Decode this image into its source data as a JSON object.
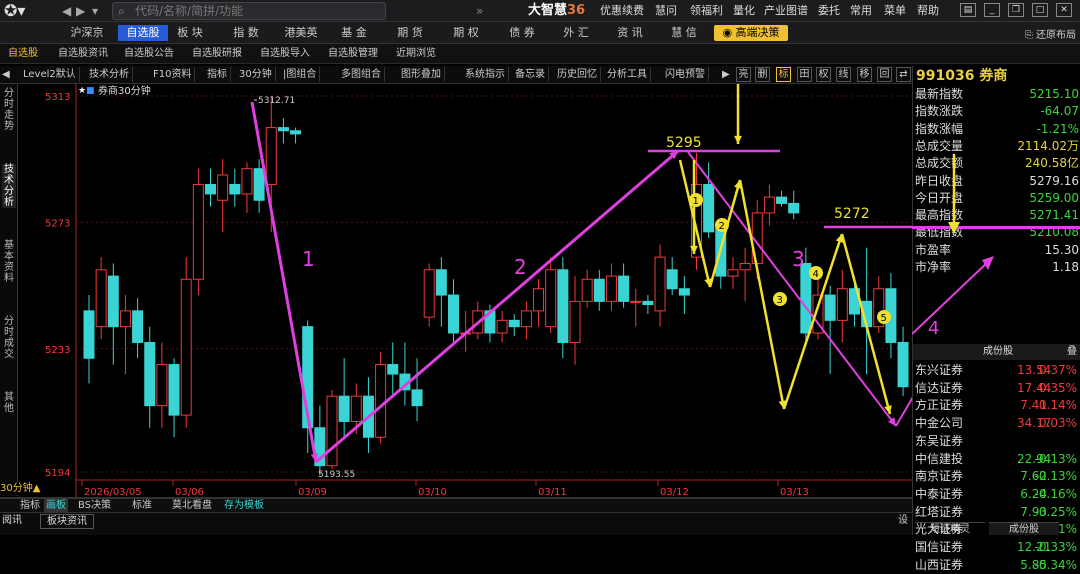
{
  "topbar": {
    "search_placeholder": "代码/名称/简拼/功能",
    "brand": "大智慧",
    "brand_num": "36",
    "menus": [
      "优惠续费",
      "慧问",
      "领福利",
      "量化",
      "产业图谱",
      "委托",
      "常用",
      "菜单",
      "帮助"
    ]
  },
  "menubar": {
    "items": [
      "沪深京",
      "自选股",
      "板 块",
      "指 数",
      "港美英",
      "基 金",
      "期 货",
      "期 权",
      "债 券",
      "外 汇",
      "资 讯",
      "慧 信"
    ],
    "gold": "高端决策",
    "restore": "还原布局"
  },
  "subbar": {
    "items": [
      "自选股",
      "自选股资讯",
      "自选股公告",
      "自选股研报",
      "自选股导入",
      "自选股管理",
      "近期浏览"
    ]
  },
  "toolbar": {
    "items": [
      "Level2默认",
      "技术分析",
      "F10资料",
      "指标",
      "30分钟",
      "|图组合",
      "多图组合",
      "图形叠加",
      "系统指示",
      "备忘录",
      "历史回忆",
      "分析工具",
      "闪电预警"
    ],
    "squares": [
      "亮",
      "删",
      "标",
      "田",
      "权",
      "线",
      "移",
      "回",
      "⇄"
    ]
  },
  "sidetabs": [
    "分时走势",
    "技术分析",
    "基本资料",
    "分时成交",
    "其他"
  ],
  "chart_data": {
    "type": "candlestick",
    "title": "券商30分钟",
    "period": "30分钟",
    "yticks": [
      "5313",
      "5273",
      "5233",
      "5194"
    ],
    "ylim": [
      5194,
      5313
    ],
    "xticks": [
      "2026/03/05",
      "03/06",
      "03/09",
      "03/10",
      "03/11",
      "03/12",
      "03/13"
    ],
    "hi_label": "5312.71",
    "lo_label": "5193.55",
    "annotations": {
      "wave_labels": [
        "1",
        "2",
        "3",
        "4"
      ],
      "level_labels": [
        "5295",
        "5272"
      ],
      "circle_labels": [
        "1",
        "2",
        "3",
        "4",
        "5"
      ]
    },
    "candles": [
      [
        5245,
        5230,
        5222,
        5250
      ],
      [
        5240,
        5258,
        5236,
        5262
      ],
      [
        5256,
        5240,
        5228,
        5260
      ],
      [
        5240,
        5245,
        5225,
        5250
      ],
      [
        5245,
        5235,
        5230,
        5249
      ],
      [
        5235,
        5215,
        5208,
        5240
      ],
      [
        5215,
        5228,
        5208,
        5235
      ],
      [
        5228,
        5212,
        5205,
        5230
      ],
      [
        5212,
        5255,
        5208,
        5262
      ],
      [
        5255,
        5285,
        5250,
        5290
      ],
      [
        5285,
        5282,
        5278,
        5290
      ],
      [
        5280,
        5288,
        5270,
        5293
      ],
      [
        5285,
        5282,
        5278,
        5290
      ],
      [
        5282,
        5290,
        5276,
        5292
      ],
      [
        5290,
        5280,
        5276,
        5293
      ],
      [
        5285,
        5303,
        5270,
        5313
      ],
      [
        5303,
        5302,
        5298,
        5306
      ],
      [
        5302,
        5301,
        5298,
        5303
      ],
      [
        5240,
        5208,
        5200,
        5242
      ],
      [
        5208,
        5196,
        5193,
        5215
      ],
      [
        5196,
        5218,
        5195,
        5220
      ],
      [
        5218,
        5210,
        5205,
        5230
      ],
      [
        5210,
        5218,
        5206,
        5222
      ],
      [
        5218,
        5205,
        5200,
        5224
      ],
      [
        5205,
        5228,
        5203,
        5232
      ],
      [
        5228,
        5225,
        5218,
        5235
      ],
      [
        5225,
        5220,
        5215,
        5235
      ],
      [
        5220,
        5215,
        5210,
        5230
      ],
      [
        5243,
        5258,
        5240,
        5260
      ],
      [
        5258,
        5250,
        5240,
        5262
      ],
      [
        5250,
        5238,
        5235,
        5255
      ],
      [
        5238,
        5238,
        5232,
        5245
      ],
      [
        5238,
        5245,
        5236,
        5248
      ],
      [
        5245,
        5238,
        5235,
        5247
      ],
      [
        5238,
        5242,
        5235,
        5245
      ],
      [
        5242,
        5240,
        5237,
        5244
      ],
      [
        5240,
        5245,
        5236,
        5248
      ],
      [
        5245,
        5252,
        5240,
        5255
      ],
      [
        5240,
        5258,
        5238,
        5262
      ],
      [
        5258,
        5235,
        5230,
        5262
      ],
      [
        5235,
        5248,
        5228,
        5256
      ],
      [
        5248,
        5255,
        5246,
        5258
      ],
      [
        5255,
        5248,
        5245,
        5258
      ],
      [
        5248,
        5256,
        5245,
        5260
      ],
      [
        5256,
        5248,
        5246,
        5260
      ],
      [
        5248,
        5248,
        5240,
        5252
      ],
      [
        5248,
        5247,
        5244,
        5250
      ],
      [
        5245,
        5262,
        5240,
        5266
      ],
      [
        5258,
        5252,
        5250,
        5262
      ],
      [
        5252,
        5250,
        5244,
        5256
      ],
      [
        5262,
        5285,
        5258,
        5295
      ],
      [
        5285,
        5270,
        5268,
        5292
      ],
      [
        5272,
        5256,
        5252,
        5274
      ],
      [
        5256,
        5258,
        5252,
        5262
      ],
      [
        5258,
        5260,
        5248,
        5265
      ],
      [
        5260,
        5276,
        5255,
        5280
      ],
      [
        5276,
        5281,
        5272,
        5285
      ],
      [
        5281,
        5279,
        5278,
        5283
      ],
      [
        5279,
        5276,
        5274,
        5283
      ],
      [
        5260,
        5238,
        5234,
        5265
      ],
      [
        5238,
        5250,
        5236,
        5255
      ],
      [
        5250,
        5242,
        5225,
        5253
      ],
      [
        5242,
        5252,
        5235,
        5258
      ],
      [
        5252,
        5244,
        5240,
        5256
      ],
      [
        5248,
        5240,
        5225,
        5265
      ],
      [
        5240,
        5252,
        5238,
        5256
      ],
      [
        5252,
        5235,
        5230,
        5257
      ],
      [
        5235,
        5221,
        5218,
        5240
      ]
    ]
  },
  "bottom": {
    "period_label": "30分钟",
    "tabs": [
      "指标",
      "画板",
      "BS决策",
      "标准",
      "莫北看盘",
      "存为模板"
    ],
    "news_tab": "板块资讯",
    "left_tag": "阅讯"
  },
  "right": {
    "title": "991036 券商",
    "quotes": [
      {
        "label": "最新指数",
        "value": "5215.10",
        "color": "#3ad43a"
      },
      {
        "label": "指数涨跌",
        "value": "-64.07",
        "color": "#3ad43a"
      },
      {
        "label": "指数涨幅",
        "value": "-1.21%",
        "color": "#3ad43a"
      },
      {
        "label": "总成交量",
        "value": "2114.02万",
        "color": "#e8d040"
      },
      {
        "label": "总成交额",
        "value": "240.58亿",
        "color": "#e8d040"
      },
      {
        "label": "昨日收盘",
        "value": "5279.16",
        "color": "#dddddd"
      },
      {
        "label": "今日开盘",
        "value": "5259.00",
        "color": "#3ad43a"
      },
      {
        "label": "最高指数",
        "value": "5271.41",
        "color": "#3ad43a"
      },
      {
        "label": "最低指数",
        "value": "5210.08",
        "color": "#3ad43a"
      },
      {
        "label": "市盈率",
        "value": "15.30",
        "color": "#dddddd"
      },
      {
        "label": "市净率",
        "value": "1.18",
        "color": "#dddddd"
      }
    ],
    "section": "成份股",
    "section_btn": "叠",
    "stocks": [
      {
        "name": "东兴证券",
        "price": "13.54",
        "change": "0.37%",
        "up": true
      },
      {
        "name": "信达证券",
        "price": "17.44",
        "change": "0.35%",
        "up": true
      },
      {
        "name": "方正证券",
        "price": "7.41",
        "change": "0.14%",
        "up": true
      },
      {
        "name": "中金公司",
        "price": "34.17",
        "change": "0.03%",
        "up": true
      },
      {
        "name": "东吴证券",
        "price": "",
        "change": "",
        "up": true
      },
      {
        "name": "中信建投",
        "price": "22.94",
        "change": "-0.13%",
        "up": false
      },
      {
        "name": "南京证券",
        "price": "7.62",
        "change": "-0.13%",
        "up": false
      },
      {
        "name": "中泰证券",
        "price": "6.24",
        "change": "-0.16%",
        "up": false
      },
      {
        "name": "红塔证券",
        "price": "7.93",
        "change": "-0.25%",
        "up": false
      },
      {
        "name": "光大证券",
        "price": "16.13",
        "change": "-0.31%",
        "up": false
      },
      {
        "name": "国信证券",
        "price": "12.21",
        "change": "-0.33%",
        "up": false
      },
      {
        "name": "山西证券",
        "price": "5.85",
        "change": "-0.34%",
        "up": false
      }
    ],
    "tabs": [
      "短线精灵",
      "成份股"
    ]
  }
}
